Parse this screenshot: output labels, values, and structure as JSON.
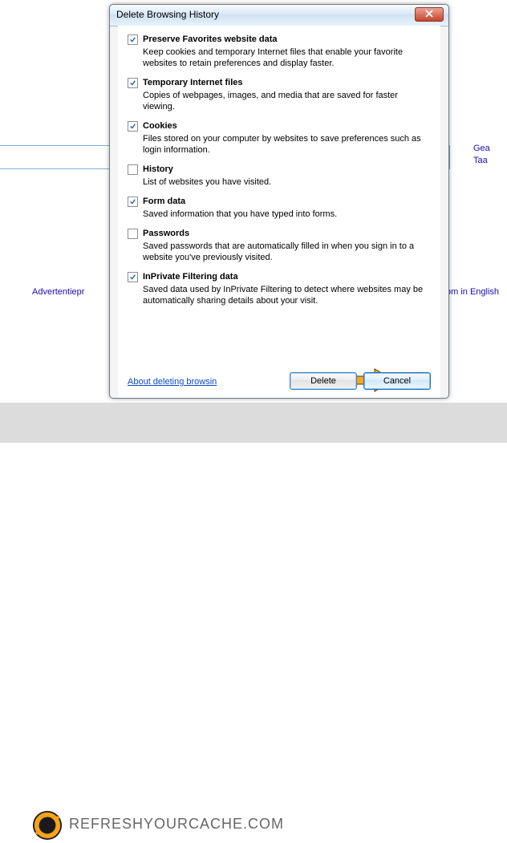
{
  "background": {
    "search_link1": "Gea",
    "search_link2": "Taa",
    "ad_link": "Advertentiepr",
    "eng_link": "om in English"
  },
  "footer": {
    "sitename": "REFRESHYOURCACHE.COM"
  },
  "dialog": {
    "title": "Delete Browsing History",
    "options": [
      {
        "checked": true,
        "label": "Preserve Favorites website data",
        "desc": "Keep cookies and temporary Internet files that enable your favorite websites to retain preferences and display faster."
      },
      {
        "checked": true,
        "label": "Temporary Internet files",
        "desc": "Copies of webpages, images, and media that are saved for faster viewing."
      },
      {
        "checked": true,
        "label": "Cookies",
        "desc": "Files stored on your computer by websites to save preferences such as login information."
      },
      {
        "checked": false,
        "label": "History",
        "desc": "List of websites you have visited."
      },
      {
        "checked": true,
        "label": "Form data",
        "desc": "Saved information that you have typed into forms."
      },
      {
        "checked": false,
        "label": "Passwords",
        "desc": "Saved passwords that are automatically filled in when you sign in to a website you've previously visited."
      },
      {
        "checked": true,
        "label": "InPrivate Filtering data",
        "desc": "Saved data used by InPrivate Filtering to detect where websites may be automatically sharing details about your visit."
      }
    ],
    "about_link": "About deleting browsin",
    "buttons": {
      "delete": "Delete",
      "cancel": "Cancel"
    }
  }
}
